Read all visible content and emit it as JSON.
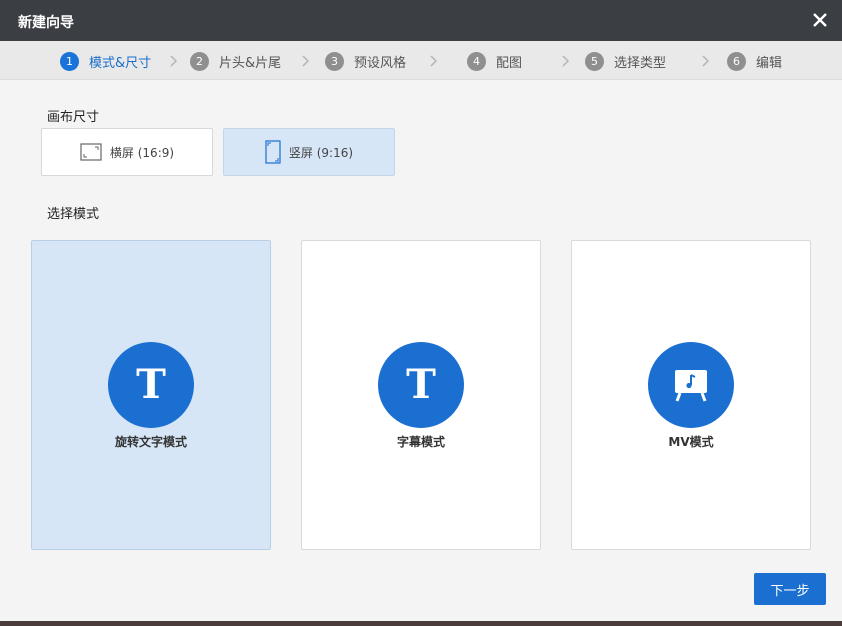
{
  "window": {
    "title": "新建向导"
  },
  "steps": [
    {
      "num": "1",
      "label": "模式&尺寸",
      "active": true
    },
    {
      "num": "2",
      "label": "片头&片尾",
      "active": false
    },
    {
      "num": "3",
      "label": "预设风格",
      "active": false
    },
    {
      "num": "4",
      "label": "配图",
      "active": false
    },
    {
      "num": "5",
      "label": "选择类型",
      "active": false
    },
    {
      "num": "6",
      "label": "编辑",
      "active": false
    }
  ],
  "canvas_size": {
    "label": "画布尺寸",
    "options": [
      {
        "label": "横屏 (16:9)",
        "icon": "landscape-frame-icon",
        "selected": false
      },
      {
        "label": "竖屏 (9:16)",
        "icon": "portrait-frame-icon",
        "selected": true
      }
    ]
  },
  "mode": {
    "label": "选择模式",
    "options": [
      {
        "name": "旋转文字模式",
        "icon": "text-t-icon",
        "selected": true
      },
      {
        "name": "字幕模式",
        "icon": "text-t-icon",
        "selected": false
      },
      {
        "name": "MV模式",
        "icon": "music-video-screen-icon",
        "selected": false
      }
    ]
  },
  "footer": {
    "next_label": "下一步"
  },
  "colors": {
    "accent": "#1a6fd1",
    "selected_bg": "#d6e6f7",
    "titlebar": "#3b3e43"
  }
}
